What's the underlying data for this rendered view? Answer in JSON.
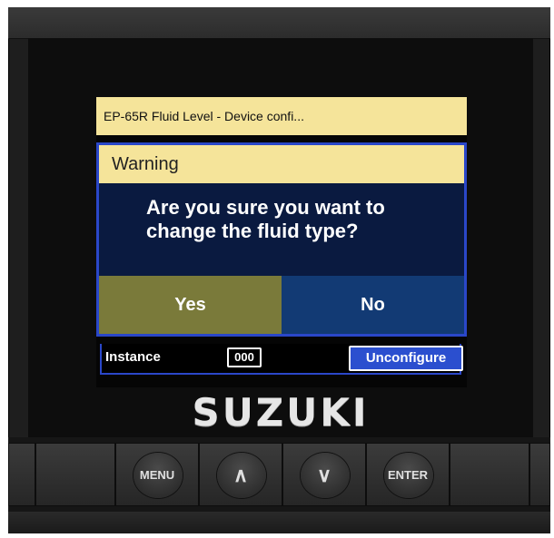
{
  "screen": {
    "title": "EP-65R Fluid Level - Device confi..."
  },
  "background_row": {
    "instance_label": "Instance",
    "instance_value": "000",
    "unconfigure_label": "Unconfigure"
  },
  "dialog": {
    "header": "Warning",
    "message": "Are you sure you want to change the fluid type?",
    "yes_label": "Yes",
    "no_label": "No"
  },
  "brand": "SUZUKI",
  "keypad": {
    "menu_label": "MENU",
    "up_symbol": "∧",
    "down_symbol": "∨",
    "enter_label": "ENTER"
  },
  "colors": {
    "title_bar": "#f5e49a",
    "dialog_border": "#2a47c9",
    "yes_button": "#7a7a3a",
    "no_button": "#123a74",
    "unconfigure_button": "#2b4fcf"
  }
}
